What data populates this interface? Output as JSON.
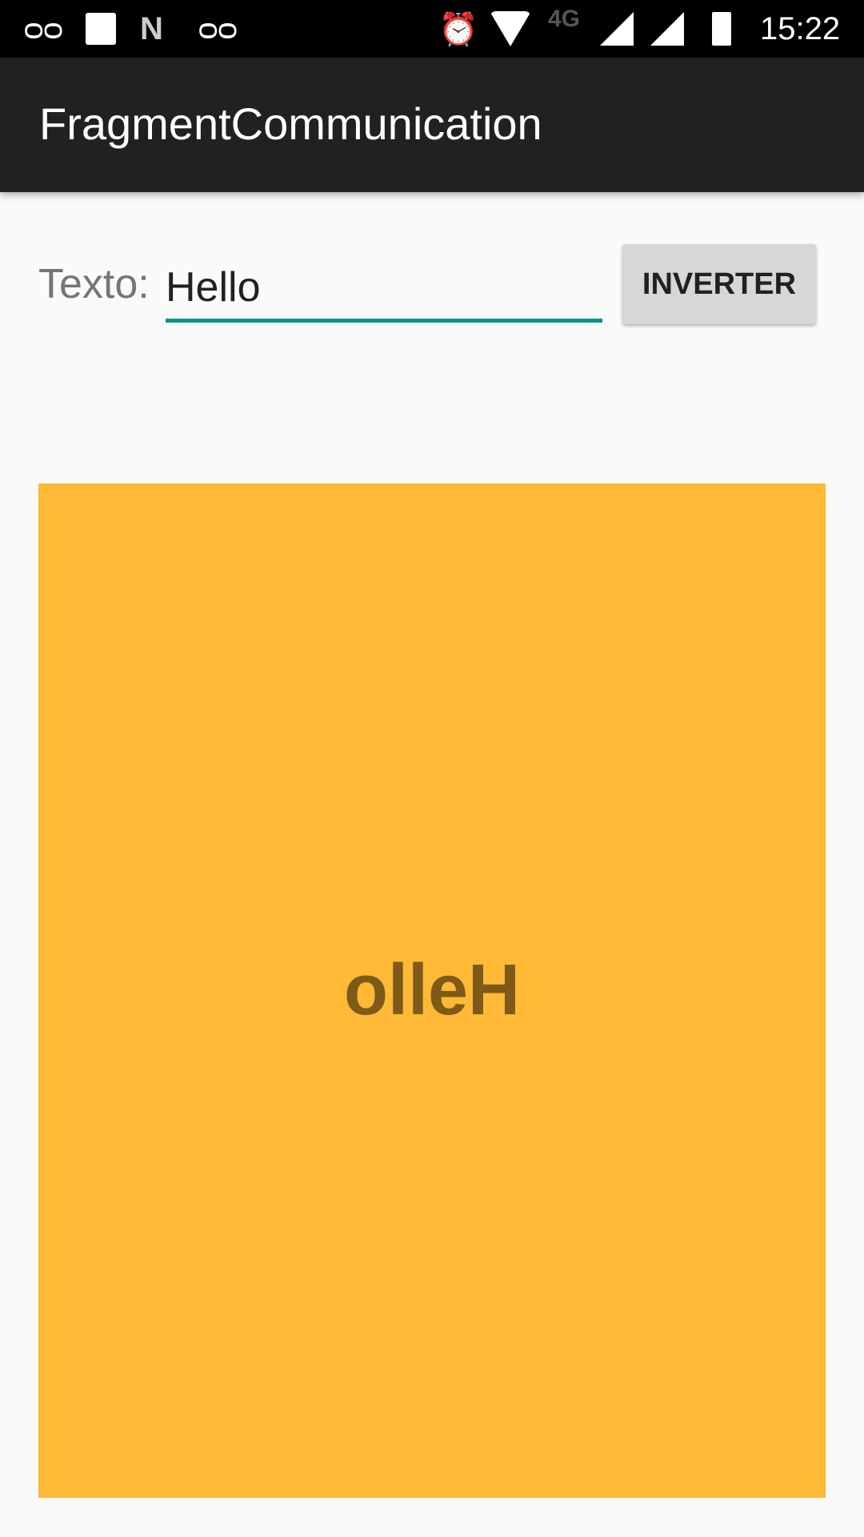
{
  "status_bar": {
    "time": "15:22",
    "network": "4G",
    "icons": [
      "voicemail-icon",
      "image-icon",
      "n-icon",
      "voicemail-icon",
      "alarm-icon",
      "wifi-icon",
      "signal-icon",
      "signal-icon",
      "battery-charging-icon"
    ]
  },
  "app_bar": {
    "title": "FragmentCommunication"
  },
  "form": {
    "label": "Texto:",
    "input_value": "Hello",
    "button_label": "INVERTER"
  },
  "result": {
    "text": "olleH",
    "background": "#ffb936"
  }
}
